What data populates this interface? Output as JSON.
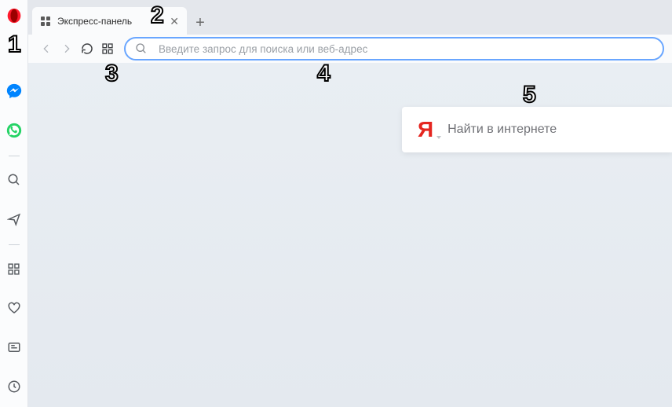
{
  "tab": {
    "title": "Экспресс-панель"
  },
  "addressbar": {
    "placeholder": "Введите запрос для поиска или веб-адрес"
  },
  "search_widget": {
    "provider_glyph": "Я",
    "placeholder": "Найти в интернете"
  },
  "callouts": {
    "c1": "1",
    "c2": "2",
    "c3": "3",
    "c4": "4",
    "c5": "5"
  }
}
